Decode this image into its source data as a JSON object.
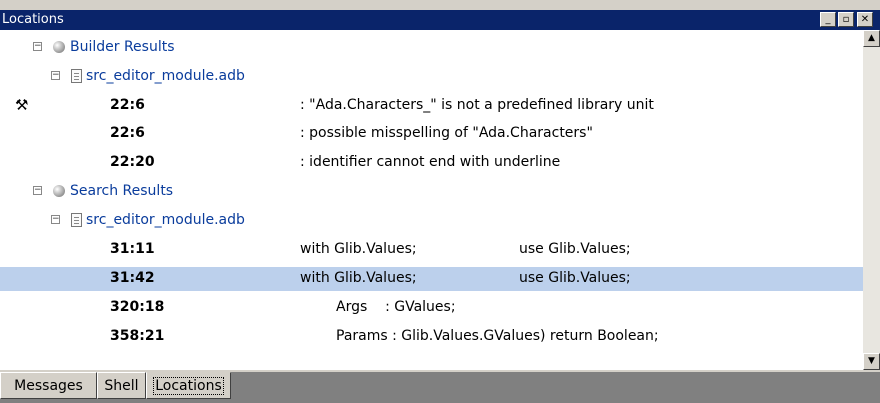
{
  "window": {
    "title": "Locations",
    "minimize_glyph": "_",
    "maximize_glyph": "▫",
    "close_glyph": "✕"
  },
  "tree": {
    "builder_category": "Builder Results",
    "builder_file": "src_editor_module.adb",
    "builder_items": [
      {
        "location": "22:6",
        "message": ": \"Ada.Characters_\" is not a predefined library unit",
        "has_action": true
      },
      {
        "location": "22:6",
        "message": ": possible misspelling of \"Ada.Characters\""
      },
      {
        "location": "22:20",
        "message": ": identifier cannot end with underline"
      }
    ],
    "search_category": "Search Results",
    "search_file": "src_editor_module.adb",
    "search_items": [
      {
        "location": "31:11",
        "message_a": "with Glib.Values;",
        "message_b": "use Glib.Values;"
      },
      {
        "location": "31:42",
        "message_a": "with Glib.Values;",
        "message_b": "use Glib.Values;",
        "selected": true
      },
      {
        "location": "320:18",
        "message_a": "Args    : GValues;"
      },
      {
        "location": "358:21",
        "message_a": "Params : Glib.Values.GValues) return Boolean;"
      }
    ]
  },
  "tabs": [
    {
      "label": "Messages"
    },
    {
      "label": "Shell"
    },
    {
      "label": "Locations",
      "active": true
    }
  ],
  "colors": {
    "titlebar": "#0a246a",
    "selection": "#bcd0ec",
    "link": "#0a3c9c"
  }
}
